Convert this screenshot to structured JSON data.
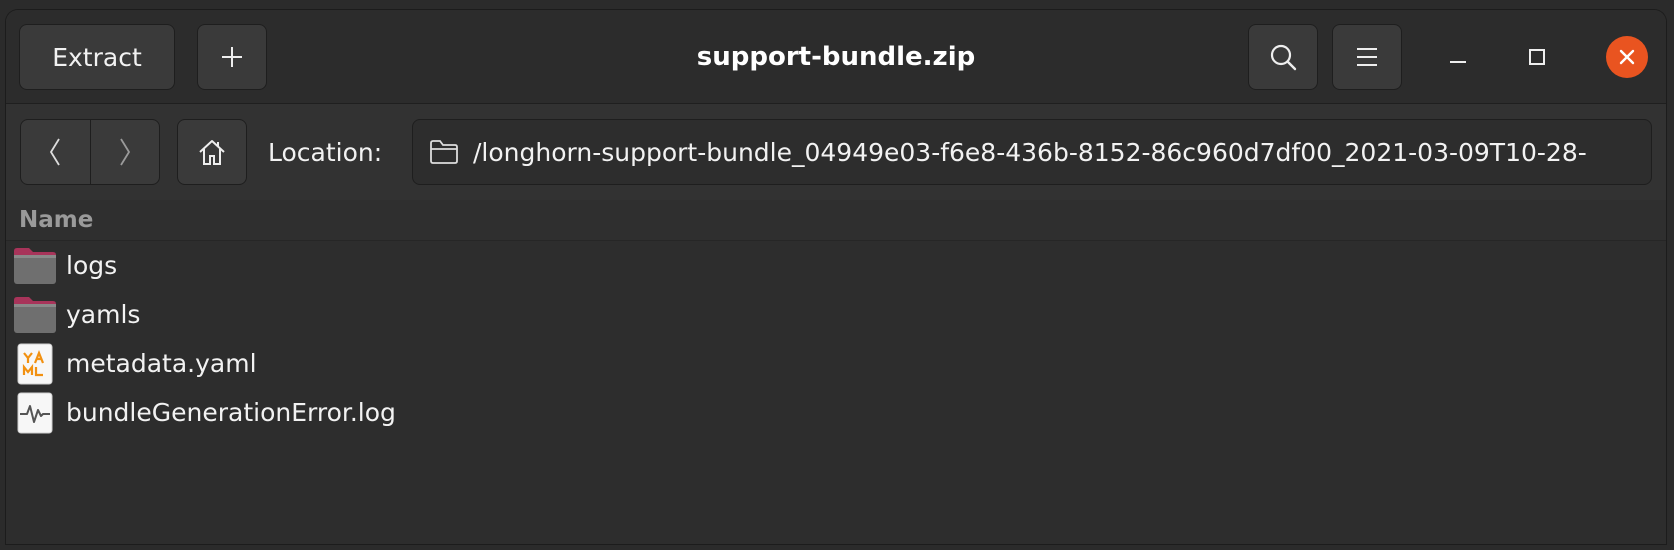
{
  "window": {
    "title": "support-bundle.zip"
  },
  "toolbar": {
    "extract_label": "Extract",
    "add_icon": "plus-icon",
    "search_icon": "search-icon",
    "menu_icon": "hamburger-menu-icon"
  },
  "location": {
    "label": "Location:",
    "path": "/longhorn-support-bundle_04949e03-f6e8-436b-8152-86c960d7df00_2021-03-09T10-28-",
    "folder_icon": "folder-outline-icon"
  },
  "list": {
    "column_name": "Name",
    "items": [
      {
        "name": "logs",
        "icon": "folder-icon"
      },
      {
        "name": "yamls",
        "icon": "folder-icon"
      },
      {
        "name": "metadata.yaml",
        "icon": "yaml-file-icon"
      },
      {
        "name": "bundleGenerationError.log",
        "icon": "log-file-icon"
      }
    ]
  },
  "colors": {
    "accent_close": "#e95420",
    "folder_tab": "#a8345a",
    "folder_body": "#6f6f6f",
    "yaml_badge": "#f29111"
  }
}
